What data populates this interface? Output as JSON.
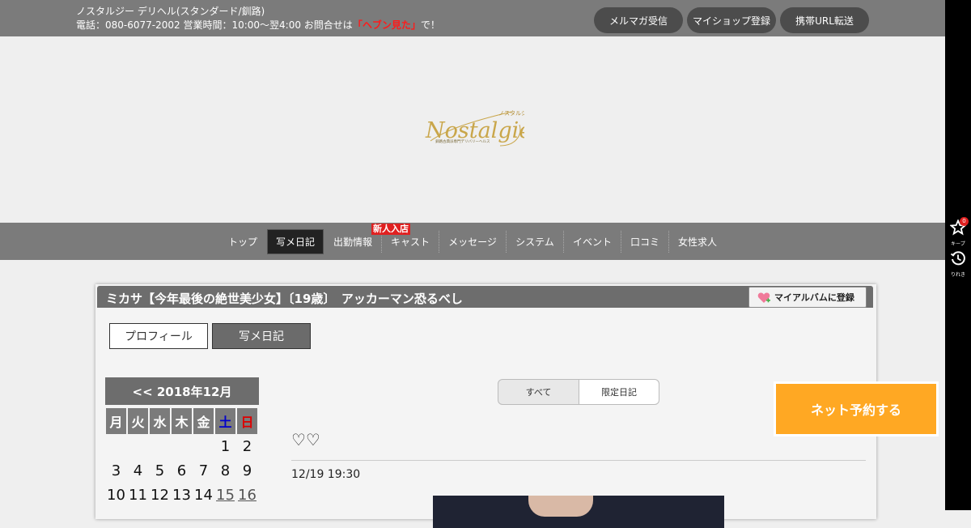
{
  "header": {
    "shop_title": "ノスタルジー デリヘル(スタンダード/釧路)",
    "contact_prefix": "電話：080-6077-2002 営業時間：10:00～翌4:00 お問合せは",
    "contact_highlight": "「ヘブン見た」",
    "contact_suffix": "で！",
    "buttons": [
      "メルマガ受信",
      "マイショップ登録",
      "携帯URL転送"
    ]
  },
  "sidebar": {
    "keep_count": "0",
    "keep_label": "キープ",
    "history_label": "りれき"
  },
  "logo": {
    "text": "Nostalgie",
    "kana": "ノスタルジー",
    "sub": "釧路古典派専門デリバリーヘルス"
  },
  "nav": {
    "items": [
      "トップ",
      "写メ日記",
      "出勤情報",
      "キャスト",
      "メッセージ",
      "システム",
      "イベント",
      "口コミ",
      "女性求人"
    ],
    "active_index": 1,
    "new_badge": "新人入店"
  },
  "panel": {
    "title": "ミカサ【今年最後の絶世美少女】〔19歳〕　アッカーマン恐るべし",
    "album_button": "マイアルバムに登録",
    "tabs": [
      "プロフィール",
      "写メ日記"
    ]
  },
  "calendar": {
    "header": "<< 2018年12月",
    "weekdays": [
      "月",
      "火",
      "水",
      "木",
      "金",
      "土",
      "日"
    ],
    "rows": [
      [
        "",
        "",
        "",
        "",
        "",
        "1",
        "2"
      ],
      [
        "3",
        "4",
        "5",
        "6",
        "7",
        "8",
        "9"
      ],
      [
        "10",
        "11",
        "12",
        "13",
        "14",
        "15",
        "16"
      ]
    ],
    "linked_days": [
      "15",
      "16"
    ]
  },
  "diary": {
    "filters": [
      "すべて",
      "限定日記"
    ],
    "post_title": "♡♡",
    "post_date": "12/19 19:30"
  },
  "reserve_button": "ネット予約する",
  "colors": {
    "header_bg": "#7b7b7b",
    "accent_red": "#ff1a1a",
    "reserve_orange": "#ffa823",
    "saturday_blue": "#0000cc",
    "sunday_red": "#dd0000"
  }
}
